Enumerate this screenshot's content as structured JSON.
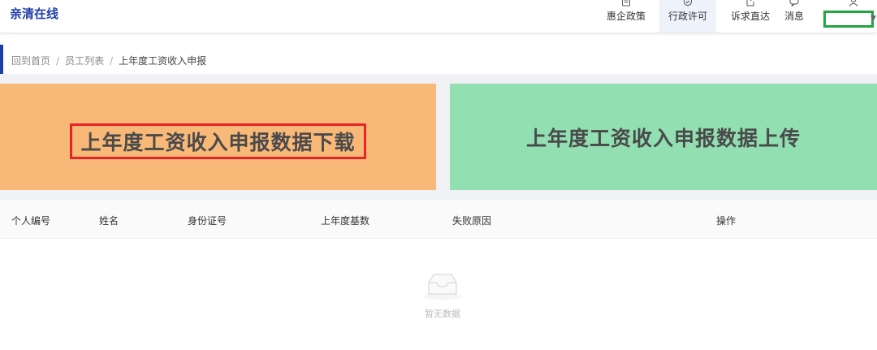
{
  "header": {
    "logo": "亲清在线",
    "nav": [
      {
        "label": "惠企政策",
        "icon": "policy-icon"
      },
      {
        "label": "行政许可",
        "icon": "shield-check-icon",
        "active": true
      },
      {
        "label": "诉求直达",
        "icon": "export-icon"
      },
      {
        "label": "消息",
        "icon": "message-icon"
      },
      {
        "label": "",
        "icon": "user-icon"
      }
    ]
  },
  "breadcrumb": {
    "home": "回到首页",
    "list": "员工列表",
    "current": "上年度工资收入申报",
    "separator": "/"
  },
  "cards": {
    "download": "上年度工资收入申报数据下载",
    "upload": "上年度工资收入申报数据上传"
  },
  "table": {
    "columns": [
      "个人编号",
      "姓名",
      "身份证号",
      "上年度基数",
      "失败原因",
      "操作"
    ],
    "rows": [],
    "empty_text": "暂无数据"
  },
  "colors": {
    "brand": "#1f3fa8",
    "download_card": "#f8b878",
    "upload_card": "#92dfb2",
    "highlight_red": "#e8232a",
    "highlight_green": "#1fa640"
  }
}
